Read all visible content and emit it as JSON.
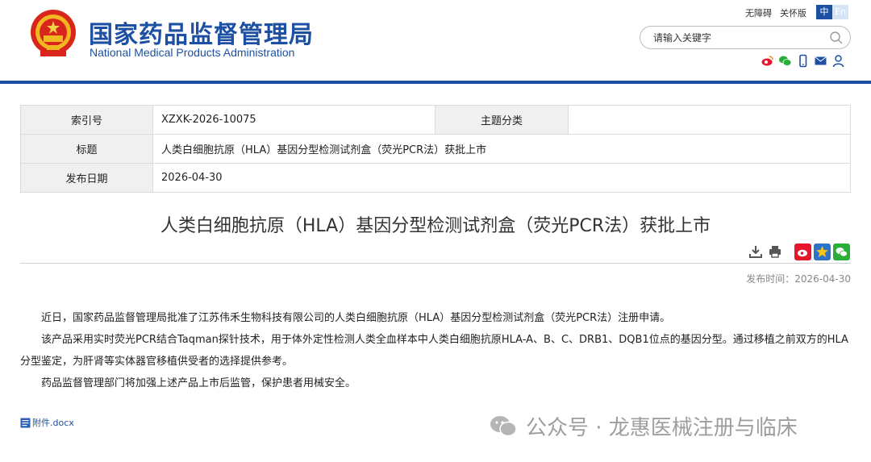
{
  "header": {
    "title_cn": "国家药品监督管理局",
    "title_en": "National Medical Products Administration",
    "links": [
      "无障碍",
      "关怀版"
    ],
    "lang_cn": "中",
    "lang_en": "En",
    "search_placeholder": "请输入关键字",
    "brand_color": "#1d50a2"
  },
  "meta": {
    "index_label": "索引号",
    "index_value": "XZXK-2026-10075",
    "category_label": "主题分类",
    "category_value": "",
    "title_label": "标题",
    "title_value": "人类白细胞抗原（HLA）基因分型检测试剂盒（荧光PCR法）获批上市",
    "date_label": "发布日期",
    "date_value": "2026-04-30"
  },
  "article": {
    "title": "人类白细胞抗原（HLA）基因分型检测试剂盒（荧光PCR法）获批上市",
    "pubtime": "发布时间：2026-04-30",
    "paragraphs": [
      "近日，国家药品监督管理局批准了江苏伟禾生物科技有限公司的人类白细胞抗原（HLA）基因分型检测试剂盒（荧光PCR法）注册申请。",
      "该产品采用实时荧光PCR结合Taqman探针技术，用于体外定性检测人类全血样本中人类白细胞抗原HLA-A、B、C、DRB1、DQB1位点的基因分型。通过移植之前双方的HLA分型鉴定，为肝肾等实体器官移植供受者的选择提供参考。",
      "药品监督管理部门将加强上述产品上市后监管，保护患者用械安全。"
    ],
    "attachment": "附件.docx"
  },
  "watermark": {
    "text": "公众号 · 龙惠医械注册与临床"
  },
  "icons": {
    "emblem": "national-emblem-icon",
    "search": "search-icon",
    "weibo": "weibo-icon",
    "wechat": "wechat-icon",
    "mobile": "mobile-icon",
    "mail": "mail-icon",
    "user": "user-icon",
    "download": "download-icon",
    "print": "print-icon"
  }
}
